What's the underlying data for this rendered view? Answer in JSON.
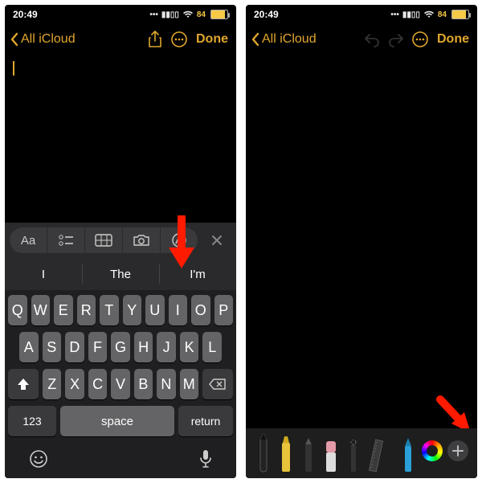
{
  "status": {
    "time": "20:49",
    "battery_pct": "84"
  },
  "nav": {
    "back_label": "All iCloud",
    "done_label": "Done"
  },
  "keyboard": {
    "suggestions": [
      "I",
      "The",
      "I'm"
    ],
    "row1": [
      "Q",
      "W",
      "E",
      "R",
      "T",
      "Y",
      "U",
      "I",
      "O",
      "P"
    ],
    "row2": [
      "A",
      "S",
      "D",
      "F",
      "G",
      "H",
      "J",
      "K",
      "L"
    ],
    "row3": [
      "Z",
      "X",
      "C",
      "V",
      "B",
      "N",
      "M"
    ],
    "num_key": "123",
    "space_label": "space",
    "return_label": "return",
    "toolbar_aa": "Aa"
  },
  "accent_color": "#e0a62d"
}
